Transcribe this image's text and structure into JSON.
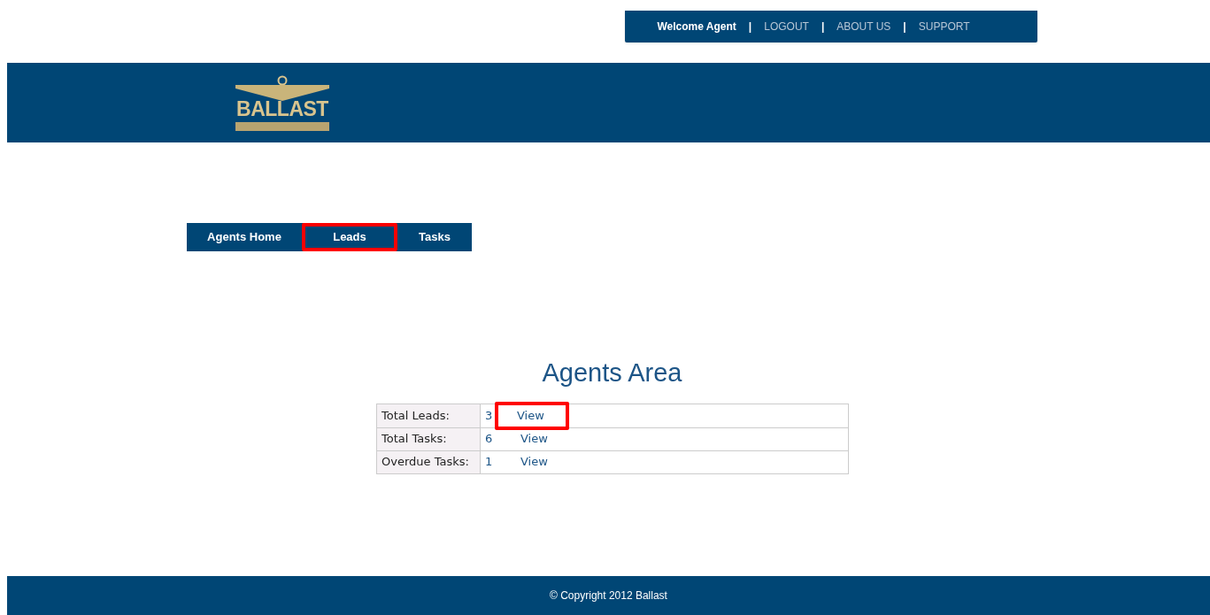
{
  "top_bar": {
    "welcome": "Welcome Agent",
    "links": [
      {
        "label": "LOGOUT",
        "separator": "|"
      },
      {
        "label": "ABOUT US",
        "separator": "|"
      },
      {
        "label": "SUPPORT",
        "separator": "|"
      }
    ]
  },
  "logo": {
    "text": "BALLAST"
  },
  "nav": [
    {
      "label": "Agents Home",
      "highlighted": false
    },
    {
      "label": "Leads",
      "highlighted": true
    },
    {
      "label": "Tasks",
      "highlighted": false
    }
  ],
  "title": "Agents Area",
  "table": {
    "rows": [
      {
        "label": "Total Leads:",
        "count": "3",
        "link": "View",
        "highlighted": true
      },
      {
        "label": "Total Tasks:",
        "count": "6",
        "link": "View",
        "highlighted": false
      },
      {
        "label": "Overdue Tasks:",
        "count": "1",
        "link": "View",
        "highlighted": false
      }
    ]
  },
  "footer": "© Copyright 2012 Ballast"
}
